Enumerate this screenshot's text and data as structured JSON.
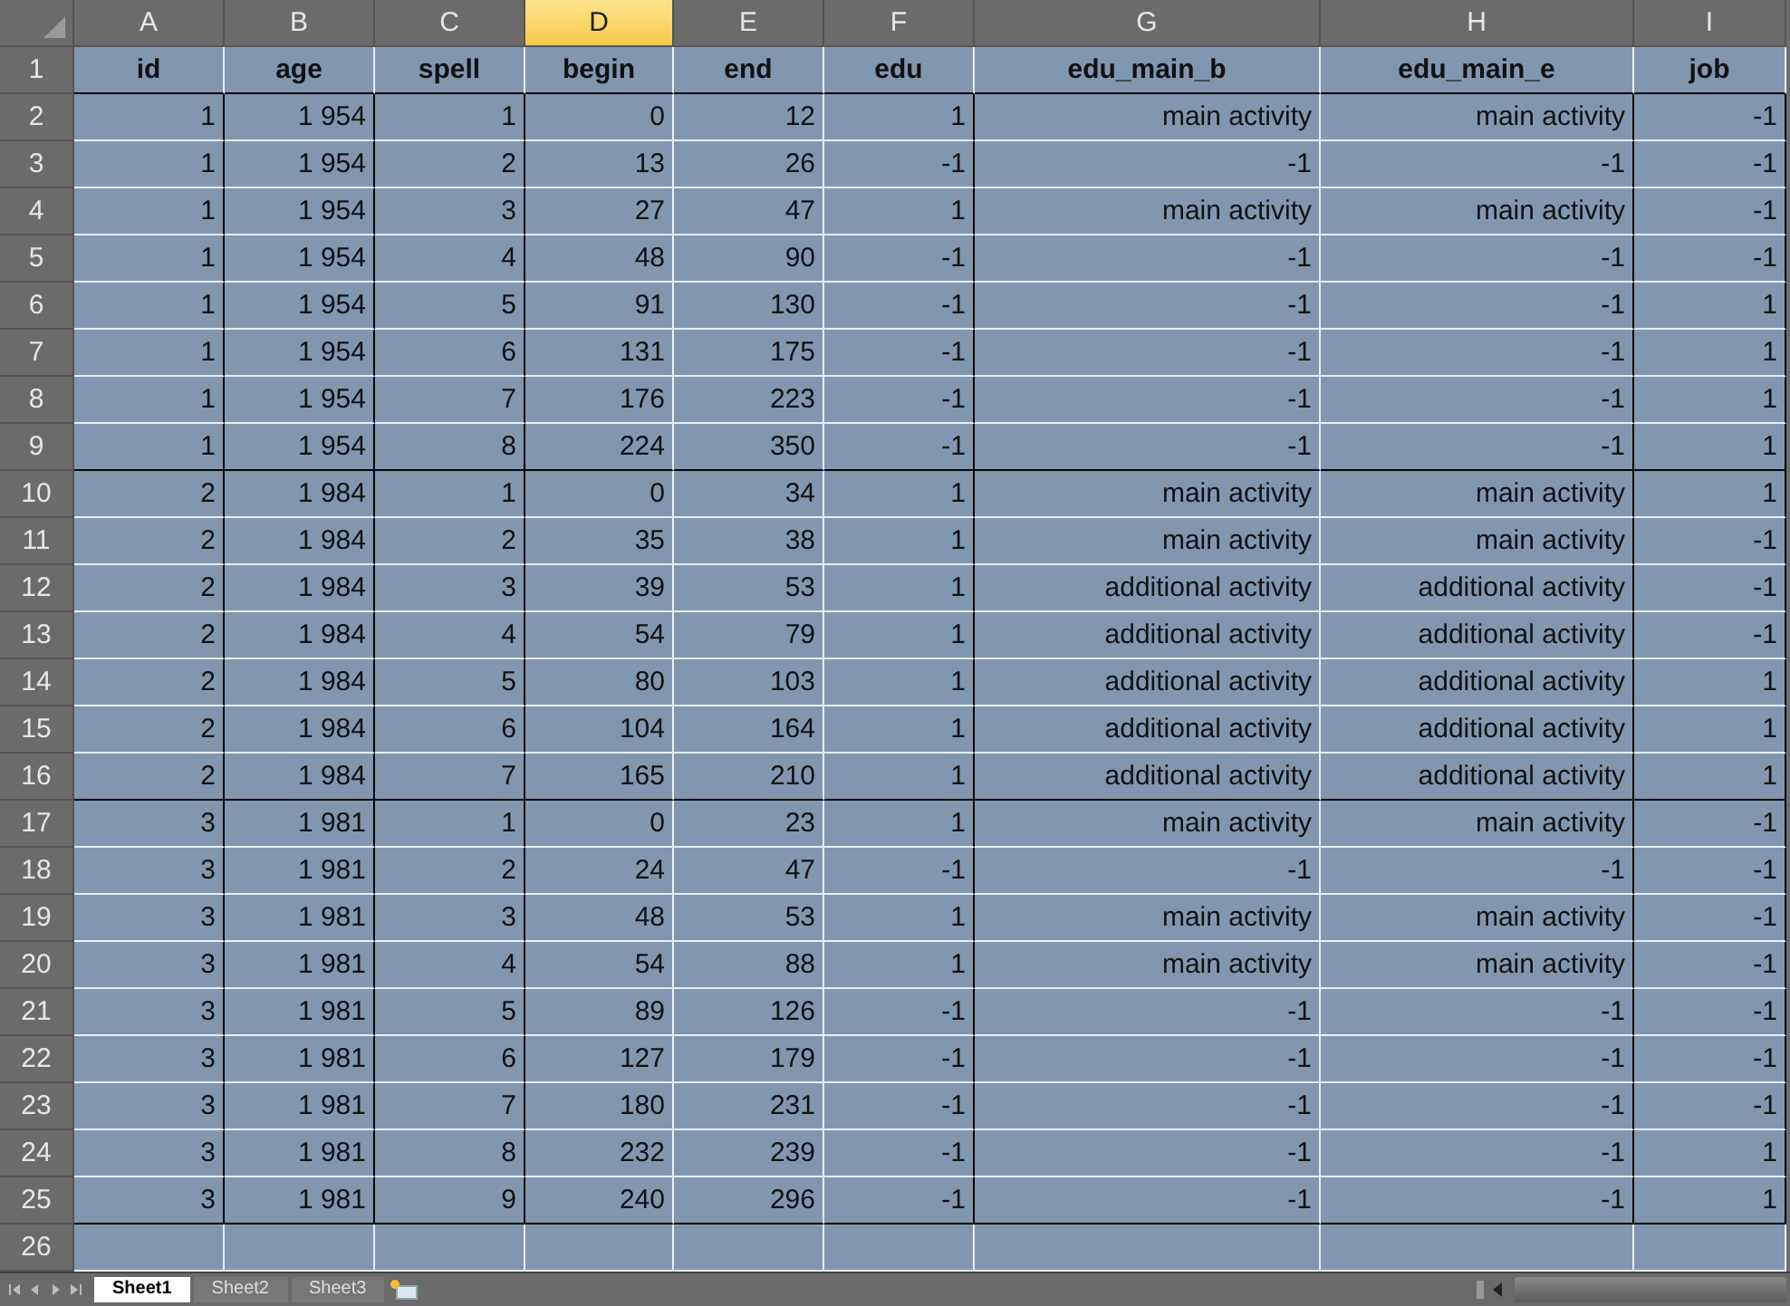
{
  "columns": [
    {
      "label": "A",
      "selected": false
    },
    {
      "label": "B",
      "selected": false
    },
    {
      "label": "C",
      "selected": false
    },
    {
      "label": "D",
      "selected": true
    },
    {
      "label": "E",
      "selected": false
    },
    {
      "label": "F",
      "selected": false
    },
    {
      "label": "G",
      "selected": false
    },
    {
      "label": "H",
      "selected": false
    },
    {
      "label": "I",
      "selected": false
    }
  ],
  "header_row": {
    "number": "1",
    "cells": [
      "id",
      "age",
      "spell",
      "begin",
      "end",
      "edu",
      "edu_main_b",
      "edu_main_e",
      "job"
    ]
  },
  "rows": [
    {
      "number": "2",
      "group_end": false,
      "cells": [
        "1",
        "1 954",
        "1",
        "0",
        "12",
        "1",
        "main activity",
        "main activity",
        "-1"
      ]
    },
    {
      "number": "3",
      "group_end": false,
      "cells": [
        "1",
        "1 954",
        "2",
        "13",
        "26",
        "-1",
        "-1",
        "-1",
        "-1"
      ]
    },
    {
      "number": "4",
      "group_end": false,
      "cells": [
        "1",
        "1 954",
        "3",
        "27",
        "47",
        "1",
        "main activity",
        "main activity",
        "-1"
      ]
    },
    {
      "number": "5",
      "group_end": false,
      "cells": [
        "1",
        "1 954",
        "4",
        "48",
        "90",
        "-1",
        "-1",
        "-1",
        "-1"
      ]
    },
    {
      "number": "6",
      "group_end": false,
      "cells": [
        "1",
        "1 954",
        "5",
        "91",
        "130",
        "-1",
        "-1",
        "-1",
        "1"
      ]
    },
    {
      "number": "7",
      "group_end": false,
      "cells": [
        "1",
        "1 954",
        "6",
        "131",
        "175",
        "-1",
        "-1",
        "-1",
        "1"
      ]
    },
    {
      "number": "8",
      "group_end": false,
      "cells": [
        "1",
        "1 954",
        "7",
        "176",
        "223",
        "-1",
        "-1",
        "-1",
        "1"
      ]
    },
    {
      "number": "9",
      "group_end": true,
      "cells": [
        "1",
        "1 954",
        "8",
        "224",
        "350",
        "-1",
        "-1",
        "-1",
        "1"
      ]
    },
    {
      "number": "10",
      "group_end": false,
      "cells": [
        "2",
        "1 984",
        "1",
        "0",
        "34",
        "1",
        "main activity",
        "main activity",
        "1"
      ]
    },
    {
      "number": "11",
      "group_end": false,
      "cells": [
        "2",
        "1 984",
        "2",
        "35",
        "38",
        "1",
        "main activity",
        "main activity",
        "-1"
      ]
    },
    {
      "number": "12",
      "group_end": false,
      "cells": [
        "2",
        "1 984",
        "3",
        "39",
        "53",
        "1",
        "additional activity",
        "additional activity",
        "-1"
      ]
    },
    {
      "number": "13",
      "group_end": false,
      "cells": [
        "2",
        "1 984",
        "4",
        "54",
        "79",
        "1",
        "additional activity",
        "additional activity",
        "-1"
      ]
    },
    {
      "number": "14",
      "group_end": false,
      "cells": [
        "2",
        "1 984",
        "5",
        "80",
        "103",
        "1",
        "additional activity",
        "additional activity",
        "1"
      ]
    },
    {
      "number": "15",
      "group_end": false,
      "cells": [
        "2",
        "1 984",
        "6",
        "104",
        "164",
        "1",
        "additional activity",
        "additional activity",
        "1"
      ]
    },
    {
      "number": "16",
      "group_end": true,
      "cells": [
        "2",
        "1 984",
        "7",
        "165",
        "210",
        "1",
        "additional activity",
        "additional activity",
        "1"
      ]
    },
    {
      "number": "17",
      "group_end": false,
      "cells": [
        "3",
        "1 981",
        "1",
        "0",
        "23",
        "1",
        "main activity",
        "main activity",
        "-1"
      ]
    },
    {
      "number": "18",
      "group_end": false,
      "cells": [
        "3",
        "1 981",
        "2",
        "24",
        "47",
        "-1",
        "-1",
        "-1",
        "-1"
      ]
    },
    {
      "number": "19",
      "group_end": false,
      "cells": [
        "3",
        "1 981",
        "3",
        "48",
        "53",
        "1",
        "main activity",
        "main activity",
        "-1"
      ]
    },
    {
      "number": "20",
      "group_end": false,
      "cells": [
        "3",
        "1 981",
        "4",
        "54",
        "88",
        "1",
        "main activity",
        "main activity",
        "-1"
      ]
    },
    {
      "number": "21",
      "group_end": false,
      "cells": [
        "3",
        "1 981",
        "5",
        "89",
        "126",
        "-1",
        "-1",
        "-1",
        "-1"
      ]
    },
    {
      "number": "22",
      "group_end": false,
      "cells": [
        "3",
        "1 981",
        "6",
        "127",
        "179",
        "-1",
        "-1",
        "-1",
        "-1"
      ]
    },
    {
      "number": "23",
      "group_end": false,
      "cells": [
        "3",
        "1 981",
        "7",
        "180",
        "231",
        "-1",
        "-1",
        "-1",
        "-1"
      ]
    },
    {
      "number": "24",
      "group_end": false,
      "cells": [
        "3",
        "1 981",
        "8",
        "232",
        "239",
        "-1",
        "-1",
        "-1",
        "1"
      ]
    },
    {
      "number": "25",
      "group_end": true,
      "cells": [
        "3",
        "1 981",
        "9",
        "240",
        "296",
        "-1",
        "-1",
        "-1",
        "1"
      ]
    }
  ],
  "empty_row": {
    "number": "26"
  },
  "sheet_tabs": [
    {
      "label": "Sheet1",
      "selected": true
    },
    {
      "label": "Sheet2",
      "selected": false
    },
    {
      "label": "Sheet3",
      "selected": false
    }
  ]
}
